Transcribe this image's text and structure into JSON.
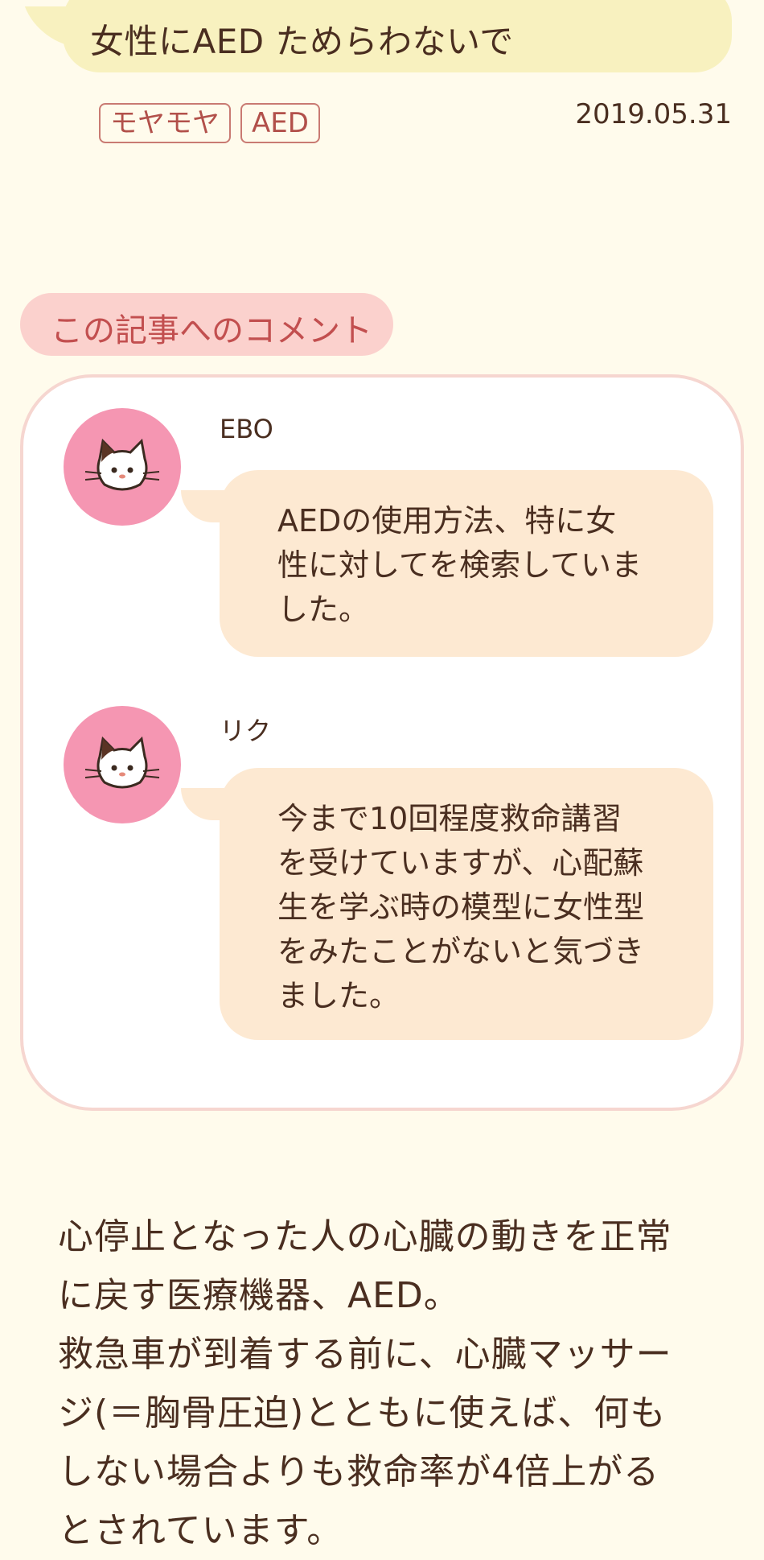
{
  "article": {
    "title": "女性にAED ためらわないで",
    "tags": [
      "モヤモヤ",
      "AED"
    ],
    "date": "2019.05.31"
  },
  "comments_section": {
    "heading": "この記事へのコメント",
    "comments": [
      {
        "user": "EBO",
        "avatar_icon": "cat-face-icon",
        "lines": [
          "AEDの使用方法、特に女",
          "性に対してを検索していま",
          "した。"
        ]
      },
      {
        "user": "リク",
        "avatar_icon": "cat-face-icon",
        "lines": [
          "今まで10回程度救命講習",
          "を受けていますが、心配蘇",
          "生を学ぶ時の模型に女性型",
          "をみたことがないと気づき",
          "ました。"
        ]
      }
    ]
  },
  "body": {
    "lines": [
      "心停止となった人の心臓の動きを正常",
      "に戻す医療機器、AED。",
      "救急車が到着する前に、心臓マッサー",
      "ジ(＝胸骨圧迫)とともに使えば、何も",
      "しない場合よりも救命率が4倍上がる",
      "とされています。"
    ]
  },
  "colors": {
    "background": "#fffbec",
    "title_bubble": "#f8f1bf",
    "tag_border": "#c97a72",
    "comment_heading_bg": "#fbd1cd",
    "avatar_bg": "#f596b2",
    "speech_bg": "#fde9d2",
    "text": "#4a2e20"
  }
}
